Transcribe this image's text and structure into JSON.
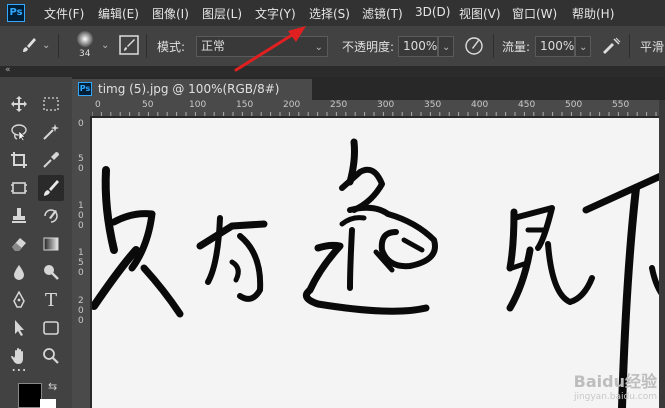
{
  "app": {
    "logo": "Ps"
  },
  "menu": [
    "文件(F)",
    "编辑(E)",
    "图像(I)",
    "图层(L)",
    "文字(Y)",
    "选择(S)",
    "滤镜(T)",
    "3D(D)",
    "视图(V)",
    "窗口(W)",
    "帮助(H)"
  ],
  "options": {
    "brush_size": "34",
    "mode_label": "模式:",
    "mode_value": "正常",
    "opacity_label": "不透明度:",
    "opacity_value": "100%",
    "flow_label": "流量:",
    "flow_value": "100%",
    "smooth_label": "平滑"
  },
  "document": {
    "tab_title": "timg (5).jpg @ 100%(RGB/8#)",
    "ruler_top": [
      "0",
      "50",
      "100",
      "150",
      "200",
      "250",
      "300",
      "350",
      "400",
      "450",
      "500",
      "550"
    ],
    "ruler_left": [
      "0",
      "5",
      "0",
      "1",
      "0",
      "0",
      "1",
      "5",
      "0",
      "2",
      "0",
      "0"
    ]
  },
  "watermark": {
    "brand": "Baidu经验",
    "url": "jingyan.baidu.com"
  },
  "tools": [
    "move-tool",
    "marquee-tool",
    "lasso-tool",
    "magic-wand-tool",
    "crop-tool",
    "eyedropper-tool",
    "frame-tool",
    "brush-tool",
    "stamp-tool",
    "history-brush-tool",
    "eraser-tool",
    "gradient-tool",
    "blur-tool",
    "dodge-tool",
    "pen-tool",
    "type-tool",
    "path-select-tool",
    "shape-tool",
    "hand-tool",
    "zoom-tool",
    "more-tool"
  ],
  "colors": {
    "accent": "#31a8ff",
    "annotation_arrow": "#e02020"
  }
}
